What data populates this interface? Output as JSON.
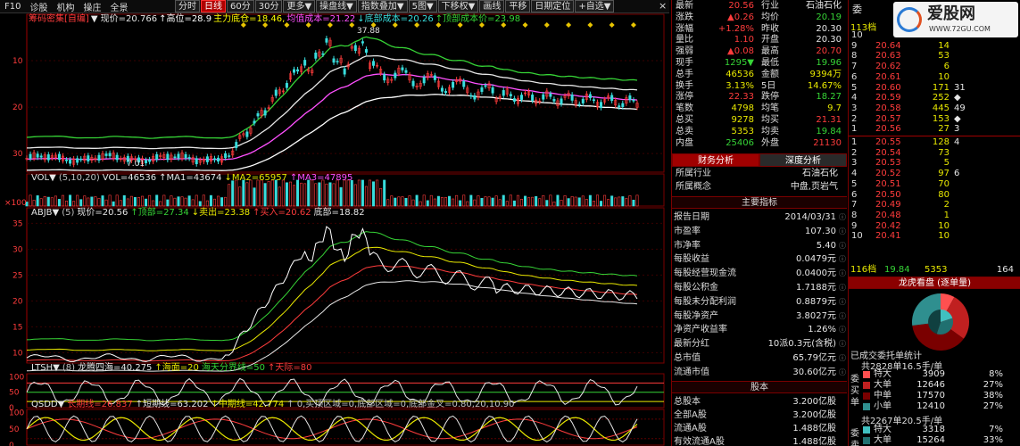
{
  "menu": {
    "items": [
      "F10",
      "诊股",
      "机构",
      "操庄",
      "全景"
    ]
  },
  "toolbar": {
    "buttons": [
      {
        "label": "分时",
        "active": false
      },
      {
        "label": "日线",
        "active": true
      },
      {
        "label": "60分",
        "active": false
      },
      {
        "label": "30分",
        "active": false
      },
      {
        "label": "更多▼",
        "active": false
      },
      {
        "label": "操盘线▼",
        "active": false
      },
      {
        "label": "指数叠加▼",
        "active": false
      },
      {
        "label": "5图▼",
        "active": false
      },
      {
        "label": "下移权▼",
        "active": false
      },
      {
        "label": "画线",
        "active": false
      },
      {
        "label": "平移",
        "active": false
      },
      {
        "label": "日期定位",
        "active": false
      },
      {
        "label": "+自选▼",
        "active": false
      }
    ]
  },
  "main_chart": {
    "legend": [
      {
        "text": "筹码密集[自编]",
        "color": "#ff3c3c"
      },
      {
        "text": "▼ 现价=20.766",
        "color": "#e6e6e6"
      },
      {
        "text": "↑高位=28.9",
        "color": "#ffffff"
      },
      {
        "text": "主力底仓=18.46,",
        "color": "#ffff00"
      },
      {
        "text": "均值成本=21.22",
        "color": "#ff50ff"
      },
      {
        "text": "↓底部成本=20.26",
        "color": "#39dede"
      },
      {
        "text": "↑顶部成本价=23.98",
        "color": "#36d436"
      }
    ],
    "y_ticks": [
      "30",
      "20",
      "10"
    ],
    "price_peak": "37.88",
    "price_low": "7.01"
  },
  "vol_panel": {
    "legend": [
      {
        "text": "VOL▼",
        "color": "#e6e6e6"
      },
      {
        "text": "(5,10,20)",
        "color": "#c0c0c0"
      },
      {
        "text": "VOL=46536",
        "color": "#e6e6e6"
      },
      {
        "text": "↑MA1=43674",
        "color": "#e6e6e6"
      },
      {
        "text": "↓MA2=65957",
        "color": "#e8e800"
      },
      {
        "text": "↑MA3=47895",
        "color": "#ff50ff"
      }
    ],
    "unit": "×100"
  },
  "abjb_panel": {
    "legend": [
      {
        "text": "ABJB▼",
        "color": "#e6e6e6"
      },
      {
        "text": "(5)",
        "color": "#c0c0c0"
      },
      {
        "text": "现价=20.56",
        "color": "#e6e6e6"
      },
      {
        "text": "↑顶部=27.34",
        "color": "#36d436"
      },
      {
        "text": "↓卖出=23.38",
        "color": "#e8e800"
      },
      {
        "text": "↑买入=20.62",
        "color": "#ff3c3c"
      },
      {
        "text": "底部=18.82",
        "color": "#e6e6e6"
      }
    ],
    "y_ticks": [
      "35",
      "30",
      "25",
      "20",
      "15",
      "10"
    ]
  },
  "ltsh_panel": {
    "legend": [
      {
        "text": "LTSH▼",
        "color": "#e6e6e6"
      },
      {
        "text": "(8)",
        "color": "#c0c0c0"
      },
      {
        "text": "龙腾四海=40.275",
        "color": "#e6e6e6"
      },
      {
        "text": "↑海面=20",
        "color": "#e8e800"
      },
      {
        "text": "海天分界线=50",
        "color": "#36d436"
      },
      {
        "text": "↑天际=80",
        "color": "#ff3c3c"
      }
    ],
    "y_ticks": [
      "100",
      "50",
      "0"
    ]
  },
  "qsdd_panel": {
    "legend": [
      {
        "text": "QSDD▼",
        "color": "#e6e6e6"
      },
      {
        "text": "长期线=26.837",
        "color": "#ff3c3c"
      },
      {
        "text": "↑短期线=63.202",
        "color": "#e6e6e6"
      },
      {
        "text": "↑中期线=42.774",
        "color": "#e8e800"
      },
      {
        "text": "↑ 0,买顶区域=0,底部区域=0,底部金叉=0.80,20,10.90",
        "color": "#c0c0c0"
      }
    ],
    "y_ticks": [
      "100",
      "50",
      "0"
    ]
  },
  "quote": {
    "rows": [
      {
        "l1": "最新",
        "v1": "20.56",
        "c1": "#ff3c3c",
        "l2": "行业",
        "v2": "石油石化",
        "c2": "#e6e6e6"
      },
      {
        "l1": "涨跌",
        "v1": "▲0.26",
        "c1": "#ff3c3c",
        "l2": "均价",
        "v2": "20.19",
        "c2": "#36d436"
      },
      {
        "l1": "涨幅",
        "v1": "+1.28%",
        "c1": "#ff3c3c",
        "l2": "昨收",
        "v2": "20.30",
        "c2": "#e6e6e6"
      },
      {
        "l1": "量比",
        "v1": "1.10",
        "c1": "#ff3c3c",
        "l2": "开盘",
        "v2": "20.30",
        "c2": "#e6e6e6"
      },
      {
        "l1": "强弱",
        "v1": "▲0.08",
        "c1": "#ff3c3c",
        "l2": "最高",
        "v2": "20.70",
        "c2": "#ff3c3c"
      },
      {
        "l1": "现手",
        "v1": "1295▼",
        "c1": "#36d436",
        "l2": "最低",
        "v2": "19.96",
        "c2": "#36d436"
      },
      {
        "l1": "总手",
        "v1": "46536",
        "c1": "#e8e800",
        "l2": "金额",
        "v2": "9394万",
        "c2": "#e8e800"
      },
      {
        "l1": "换手",
        "v1": "3.13%",
        "c1": "#e8e800",
        "l2": "5日",
        "v2": "14.67%",
        "c2": "#e8e800"
      },
      {
        "l1": "涨停",
        "v1": "22.33",
        "c1": "#ff3c3c",
        "l2": "跌停",
        "v2": "18.27",
        "c2": "#36d436"
      },
      {
        "l1": "笔数",
        "v1": "4798",
        "c1": "#e8e800",
        "l2": "均笔",
        "v2": "9.7",
        "c2": "#e8e800"
      },
      {
        "l1": "总买",
        "v1": "9278",
        "c1": "#e8e800",
        "l2": "均买",
        "v2": "21.31",
        "c2": "#ff3c3c"
      },
      {
        "l1": "总卖",
        "v1": "5353",
        "c1": "#e8e800",
        "l2": "均卖",
        "v2": "19.84",
        "c2": "#36d436"
      },
      {
        "l1": "内盘",
        "v1": "25406",
        "c1": "#36d436",
        "l2": "外盘",
        "v2": "21130",
        "c2": "#ff3c3c"
      }
    ],
    "tabs": [
      "财务分析",
      "深度分析"
    ],
    "industry": [
      {
        "label": "所属行业",
        "value": "石油石化"
      },
      {
        "label": "所属概念",
        "value": "中盘,页岩气"
      }
    ],
    "main_title": "主要指标",
    "indicators": [
      {
        "label": "报告日期",
        "value": "2014/03/31"
      },
      {
        "label": "市盈率",
        "value": "107.30"
      },
      {
        "label": "市净率",
        "value": "5.40"
      },
      {
        "label": "每股收益",
        "value": "0.0479元"
      },
      {
        "label": "每股经营现金流",
        "value": "0.0400元"
      },
      {
        "label": "每股公积金",
        "value": "1.7188元"
      },
      {
        "label": "每股未分配利润",
        "value": "0.8879元"
      },
      {
        "label": "每股净资产",
        "value": "3.8027元"
      },
      {
        "label": "净资产收益率",
        "value": "1.26%"
      },
      {
        "label": "最新分红",
        "value": "10派0.3元(含税)"
      },
      {
        "label": "总市值",
        "value": "65.79亿元"
      },
      {
        "label": "流通市值",
        "value": "30.60亿元"
      }
    ],
    "share_title": "股本",
    "shares": [
      {
        "label": "总股本",
        "value": "3.200亿股"
      },
      {
        "label": "全部A股",
        "value": "3.200亿股"
      },
      {
        "label": "流通A股",
        "value": "1.488亿股"
      },
      {
        "label": "有效流通A股",
        "value": "1.488亿股"
      }
    ]
  },
  "orderbook": {
    "header_left": "委",
    "logo": "爱股网",
    "logo_url": "WWW.72GU.COM",
    "sell_header": "113档",
    "sells": [
      {
        "lvl": "10",
        "price": "",
        "vol": "",
        "mark": ""
      },
      {
        "lvl": "9",
        "price": "20.64",
        "vol": "14",
        "mark": ""
      },
      {
        "lvl": "8",
        "price": "20.63",
        "vol": "53",
        "mark": ""
      },
      {
        "lvl": "7",
        "price": "20.62",
        "vol": "6",
        "mark": ""
      },
      {
        "lvl": "6",
        "price": "20.61",
        "vol": "10",
        "mark": ""
      },
      {
        "lvl": "5",
        "price": "20.60",
        "vol": "171",
        "mark": "31"
      },
      {
        "lvl": "4",
        "price": "20.59",
        "vol": "252",
        "mark": "◆"
      },
      {
        "lvl": "3",
        "price": "20.58",
        "vol": "445",
        "mark": "49"
      },
      {
        "lvl": "2",
        "price": "20.57",
        "vol": "153",
        "mark": "◆"
      },
      {
        "lvl": "1",
        "price": "20.56",
        "vol": "27",
        "mark": "3"
      }
    ],
    "buys": [
      {
        "lvl": "1",
        "price": "20.55",
        "vol": "128",
        "mark": "4"
      },
      {
        "lvl": "2",
        "price": "20.54",
        "vol": "73",
        "mark": ""
      },
      {
        "lvl": "3",
        "price": "20.53",
        "vol": "5",
        "mark": ""
      },
      {
        "lvl": "4",
        "price": "20.52",
        "vol": "97",
        "mark": "6"
      },
      {
        "lvl": "5",
        "price": "20.51",
        "vol": "70",
        "mark": ""
      },
      {
        "lvl": "6",
        "price": "20.50",
        "vol": "80",
        "mark": ""
      },
      {
        "lvl": "7",
        "price": "20.49",
        "vol": "2",
        "mark": ""
      },
      {
        "lvl": "8",
        "price": "20.48",
        "vol": "1",
        "mark": ""
      },
      {
        "lvl": "9",
        "price": "20.42",
        "vol": "10",
        "mark": ""
      },
      {
        "lvl": "10",
        "price": "20.41",
        "vol": "10",
        "mark": ""
      }
    ],
    "footer": {
      "left": "116档",
      "price": "19.84",
      "vol": "5353",
      "right": "164"
    },
    "dragon_title": "龙虎看盘 (逐单量)",
    "pie": [
      {
        "value": 0.08,
        "color": "#ff5050"
      },
      {
        "value": 0.27,
        "color": "#c02020"
      },
      {
        "value": 0.38,
        "color": "#7a0000"
      },
      {
        "value": 0.27,
        "color": "#2f8f8f"
      }
    ],
    "pie_inner": [
      {
        "value": 0.2,
        "color": "#40c0c0"
      },
      {
        "value": 0.35,
        "color": "#207070"
      },
      {
        "value": 0.45,
        "color": "#104040"
      }
    ],
    "stats_title": "已成交委托单统计",
    "buy_summary": "共2828单16.5手/单",
    "buy_stats": [
      {
        "label": "特大",
        "vol": "3909",
        "pct": "8%",
        "color": "#ff5050"
      },
      {
        "label": "大单",
        "vol": "12646",
        "pct": "27%",
        "color": "#c02020"
      },
      {
        "label": "中单",
        "vol": "17570",
        "pct": "38%",
        "color": "#7a0000"
      },
      {
        "label": "小单",
        "vol": "12410",
        "pct": "27%",
        "color": "#2f8f8f"
      }
    ],
    "side_buy": [
      "委",
      "买",
      "单"
    ],
    "sell_summary": "共2267单20.5手/单",
    "sell_stats": [
      {
        "label": "特大",
        "vol": "3318",
        "pct": "7%",
        "color": "#40c0c0"
      },
      {
        "label": "大单",
        "vol": "15264",
        "pct": "33%",
        "color": "#207070"
      }
    ],
    "side_sell": [
      "委",
      "卖"
    ]
  }
}
